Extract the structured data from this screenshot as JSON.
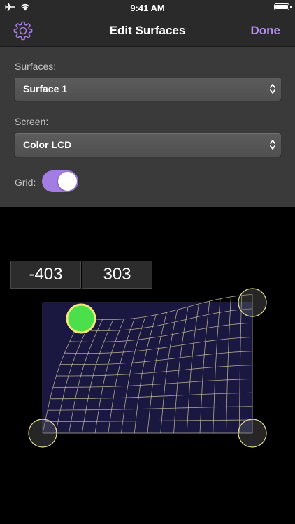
{
  "status_bar": {
    "time": "9:41 AM",
    "icons": [
      "airplane-icon",
      "wifi-icon",
      "battery-icon"
    ]
  },
  "nav": {
    "title": "Edit Surfaces",
    "done_label": "Done",
    "left_icon": "gear-icon"
  },
  "settings": {
    "surfaces_label": "Surfaces:",
    "surfaces_value": "Surface 1",
    "screen_label": "Screen:",
    "screen_value": "Color LCD",
    "grid_label": "Grid:",
    "grid_enabled": true
  },
  "coordinates": {
    "x": "-403",
    "y": "303"
  },
  "colors": {
    "accent": "#b38cf0",
    "toggle_on": "#a47de3",
    "grid_line": "#c8c29a",
    "active_handle": "#4be04b",
    "handle_outline": "#e5e08a",
    "surface_fill": "#1a1840"
  }
}
